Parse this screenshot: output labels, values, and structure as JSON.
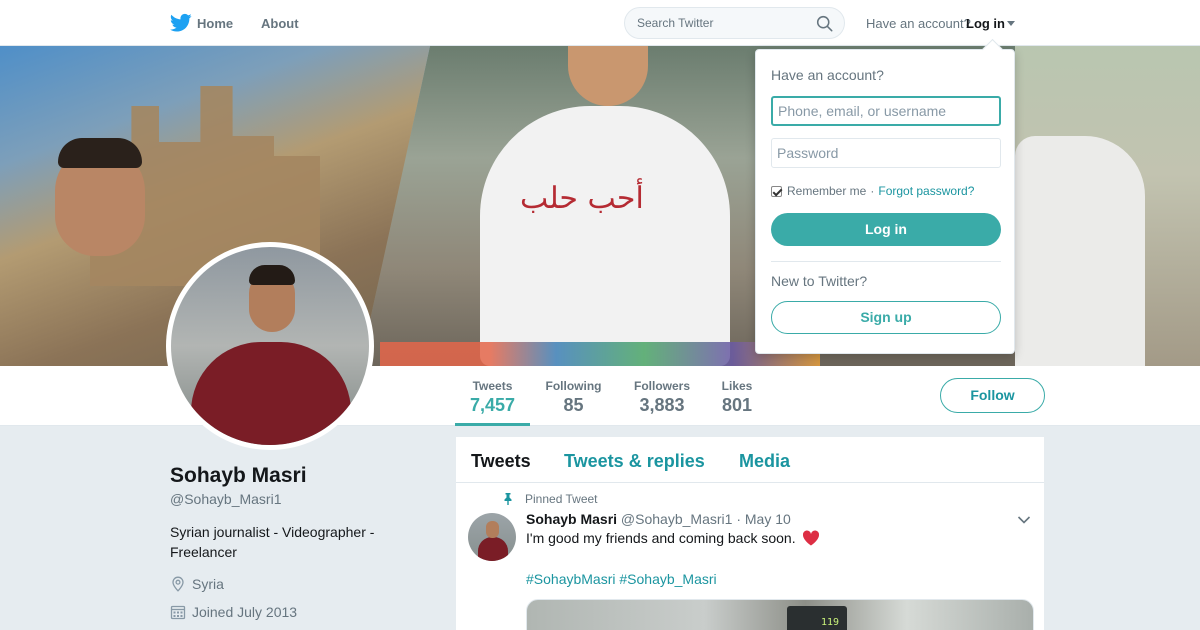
{
  "nav": {
    "home": "Home",
    "about": "About"
  },
  "search": {
    "placeholder": "Search Twitter"
  },
  "account": {
    "prompt": "Have an account?",
    "login_toggle": "Log in"
  },
  "login_dropdown": {
    "title": "Have an account?",
    "username_placeholder": "Phone, email, or username",
    "password_placeholder": "Password",
    "remember_me": "Remember me",
    "separator": "·",
    "forgot_password": "Forgot password?",
    "login_button": "Log in",
    "new_prompt": "New to Twitter?",
    "signup_button": "Sign up"
  },
  "banner": {
    "shirt_text": "أحب حلب",
    "monitor_text": "119"
  },
  "stats": [
    {
      "label": "Tweets",
      "value": "7,457"
    },
    {
      "label": "Following",
      "value": "85"
    },
    {
      "label": "Followers",
      "value": "3,883"
    },
    {
      "label": "Likes",
      "value": "801"
    }
  ],
  "follow_button": "Follow",
  "profile": {
    "name": "Sohayb Masri",
    "handle": "@Sohayb_Masri1",
    "bio": "Syrian journalist - Videographer - Freelancer",
    "location": "Syria",
    "joined": "Joined July 2013"
  },
  "timeline": {
    "tabs": [
      "Tweets",
      "Tweets & replies",
      "Media"
    ],
    "pinned_label": "Pinned Tweet",
    "tweet": {
      "name": "Sohayb Masri",
      "handle": "@Sohayb_Masri1",
      "separator": "·",
      "date": "May 10",
      "text": "I'm good my friends and coming back soon.",
      "hashtags": "#SohaybMasri #Sohayb_Masri"
    }
  },
  "colors": {
    "accent": "#3aaba8",
    "link": "#1b95a0",
    "twitter_blue": "#1da1f2",
    "background": "#e6ecf0",
    "heart": "#e0245e"
  }
}
